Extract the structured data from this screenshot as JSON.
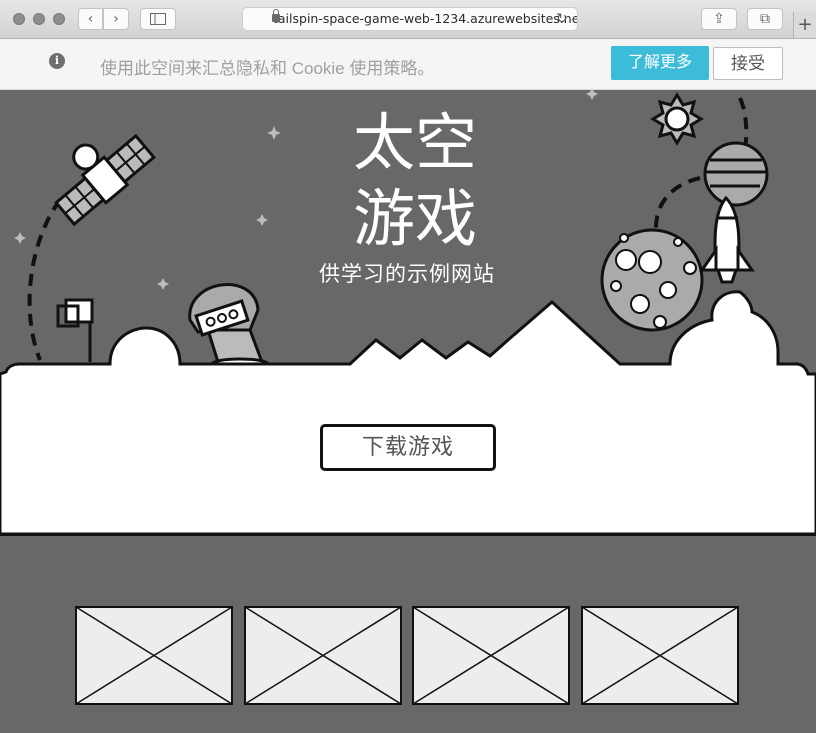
{
  "browser": {
    "url": "tailspin-space-game-web-1234.azurewebsites.net",
    "back_glyph": "‹",
    "forward_glyph": "›",
    "reload_glyph": "↻",
    "share_glyph": "⇪",
    "tabs_glyph": "⧉",
    "new_tab_glyph": "+"
  },
  "cookie_bar": {
    "info_glyph": "i",
    "message": "使用此空间来汇总隐私和 Cookie 使用策略。",
    "learn_more": "了解更多",
    "accept": "接受"
  },
  "hero": {
    "title_line1": "太空",
    "title_line2": "游戏",
    "subtitle": "供学习的示例网站"
  },
  "main": {
    "download_button": "下载游戏"
  },
  "gallery": {
    "thumbnails": [
      "image-placeholder",
      "image-placeholder",
      "image-placeholder",
      "image-placeholder"
    ]
  },
  "colors": {
    "hero_bg": "#686868",
    "accent": "#3cbcd9"
  }
}
